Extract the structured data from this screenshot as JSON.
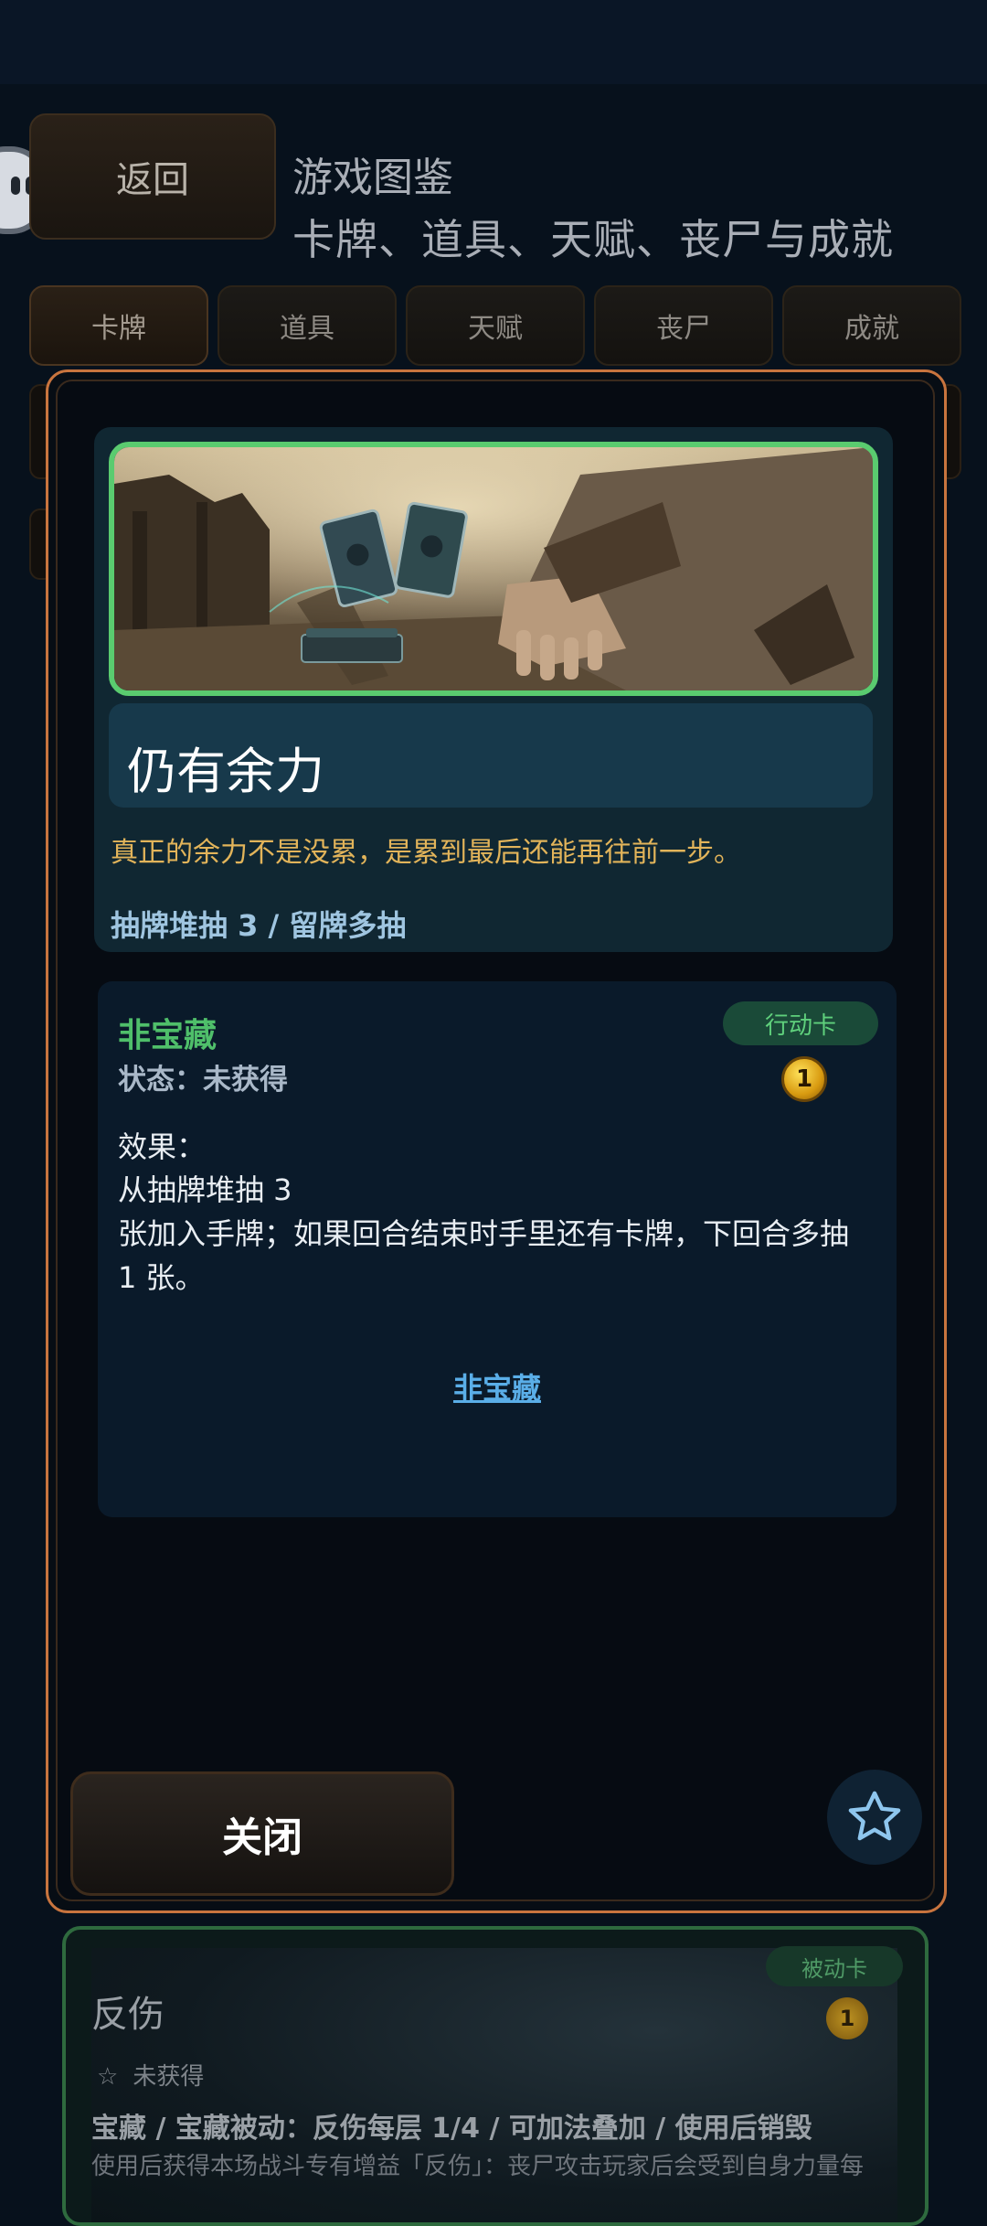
{
  "header": {
    "back_label": "返回",
    "title": "游戏图鉴",
    "subtitle": "卡牌、道具、天赋、丧尸与成就"
  },
  "tabs": [
    {
      "label": "卡牌",
      "active": true
    },
    {
      "label": "道具",
      "active": false
    },
    {
      "label": "天赋",
      "active": false
    },
    {
      "label": "丧尸",
      "active": false
    },
    {
      "label": "成就",
      "active": false
    }
  ],
  "modal": {
    "card_name": "仍有余力",
    "flavor_text": "真正的余力不是没累，是累到最后还能再往前一步。",
    "tags": "抽牌堆抽 3 / 留牌多抽",
    "rarity": "非宝藏",
    "status": "状态：未获得",
    "type_badge": "行动卡",
    "cost": "1",
    "effect_label": "效果：",
    "effect_line1": "从抽牌堆抽 3",
    "effect_line2": "张加入手牌；如果回合结束时手里还有卡牌，下回合多抽 1 张。",
    "link_label": "非宝藏",
    "close_label": "关闭",
    "favorite_icon": "star-icon"
  },
  "bottom_card": {
    "name": "反伤",
    "type_badge": "被动卡",
    "cost": "1",
    "status": "未获得",
    "tags": "宝藏 / 宝藏被动：反伤每层 1/4 / 可加法叠加 / 使用后销毁",
    "description": "使用后获得本场战斗专有增益「反伤」：丧尸攻击玩家后会受到自身力量每"
  },
  "colors": {
    "accent_orange": "#c8743e",
    "rare_green": "#5acb6f",
    "quote_gold": "#e2b45a",
    "link_blue": "#5aaee8"
  }
}
